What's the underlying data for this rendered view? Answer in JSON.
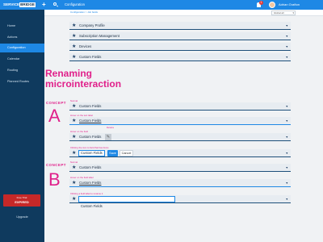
{
  "app": {
    "logo_part1": "SERVICE",
    "logo_part2": "BRIDGE",
    "page_title": "Configuration",
    "notifications_count": "1",
    "user_name": "Adrian Grafton"
  },
  "subheader": {
    "breadcrumb": "Configuration > Job fields",
    "filter_value": "Global all"
  },
  "sidebar": {
    "items": [
      {
        "label": "Home"
      },
      {
        "label": "Actions"
      },
      {
        "label": "Configuration"
      },
      {
        "label": "Calendar"
      },
      {
        "label": "Routing"
      },
      {
        "label": "Planned Routes"
      }
    ],
    "trial_line1": "Free Trial",
    "trial_line2": "EXPIRED",
    "upgrade_label": "Upgrade"
  },
  "sections": {
    "top_rows": [
      {
        "label": "Company Profile"
      },
      {
        "label": "Subscription Management"
      },
      {
        "label": "Devices"
      },
      {
        "label": "Custom Fields"
      }
    ]
  },
  "heading": {
    "line1": "Renaming",
    "line2": "microinteraction"
  },
  "concept_a": {
    "label": "CONCEPT",
    "letter": "A",
    "notes": [
      "Normal",
      "Hover on the text label",
      "Hover on the field",
      "Clicking the icon to field that has focus"
    ],
    "tooltip": "Rename",
    "field_label": "Custom Fields",
    "save_label": "Save",
    "cancel_label": "Cancel"
  },
  "concept_b": {
    "label": "CONCEPT",
    "letter": "B",
    "notes": [
      "Normal",
      "Hover on the field label",
      "Clicking a field label to rename it"
    ],
    "field_label": "Custom Fields"
  },
  "icons": {
    "row_icon": "star-icon",
    "row_chevron": "chevron-down-icon",
    "edit_icon": "pencil-icon",
    "search_icon": "search-icon",
    "add_icon": "plus-icon",
    "notification_icon": "bell-icon"
  },
  "colors": {
    "brand_blue": "#1e88e5",
    "sidebar_bg": "#0f3a5e",
    "accent_pink": "#e0208a",
    "trial_red": "#c62828"
  }
}
